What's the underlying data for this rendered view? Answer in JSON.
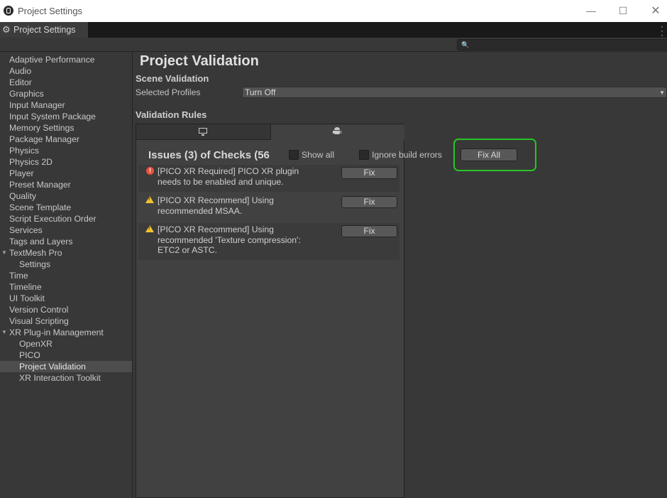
{
  "window": {
    "title": "Project Settings",
    "controls": {
      "minimize": "—",
      "maximize": "☐",
      "close": "✕"
    }
  },
  "tab": {
    "label": "Project Settings",
    "icon": "gear-icon"
  },
  "search": {
    "placeholder": ""
  },
  "sidebar": {
    "items": [
      {
        "label": "Adaptive Performance"
      },
      {
        "label": "Audio"
      },
      {
        "label": "Editor"
      },
      {
        "label": "Graphics"
      },
      {
        "label": "Input Manager"
      },
      {
        "label": "Input System Package"
      },
      {
        "label": "Memory Settings"
      },
      {
        "label": "Package Manager"
      },
      {
        "label": "Physics"
      },
      {
        "label": "Physics 2D"
      },
      {
        "label": "Player"
      },
      {
        "label": "Preset Manager"
      },
      {
        "label": "Quality"
      },
      {
        "label": "Scene Template"
      },
      {
        "label": "Script Execution Order"
      },
      {
        "label": "Services"
      },
      {
        "label": "Tags and Layers"
      },
      {
        "label": "TextMesh Pro"
      },
      {
        "label": "Settings"
      },
      {
        "label": "Time"
      },
      {
        "label": "Timeline"
      },
      {
        "label": "UI Toolkit"
      },
      {
        "label": "Version Control"
      },
      {
        "label": "Visual Scripting"
      },
      {
        "label": "XR Plug-in Management"
      },
      {
        "label": "OpenXR"
      },
      {
        "label": "PICO"
      },
      {
        "label": "Project Validation"
      },
      {
        "label": "XR Interaction Toolkit"
      }
    ],
    "selected": "Project Validation"
  },
  "main": {
    "title": "Project Validation",
    "scene_validation": {
      "heading": "Scene Validation",
      "selected_profiles_label": "Selected Profiles",
      "selected_profiles_value": "Turn Off"
    },
    "validation_rules": {
      "heading": "Validation Rules",
      "platform_tabs": [
        {
          "icon": "monitor-icon",
          "selected": false
        },
        {
          "icon": "android-icon",
          "selected": true
        }
      ],
      "issues_title": "Issues (3) of Checks (56",
      "show_all_label": "Show all",
      "show_all_checked": false,
      "ignore_build_errors_label": "Ignore build errors",
      "ignore_build_errors_checked": false,
      "fix_all_label": "Fix All",
      "rules": [
        {
          "severity": "error",
          "message": "[PICO XR Required] PICO XR plugin needs to be enabled and unique.",
          "fix_label": "Fix"
        },
        {
          "severity": "warning",
          "message": "[PICO XR Recommend] Using recommended MSAA.",
          "fix_label": "Fix"
        },
        {
          "severity": "warning",
          "message": "[PICO XR Recommend] Using recommended 'Texture compression': ETC2 or ASTC.",
          "fix_label": "Fix"
        }
      ]
    }
  },
  "colors": {
    "background": "#383838",
    "highlight_outline": "#27c427",
    "error": "#e8523b",
    "warning": "#f2c230"
  }
}
